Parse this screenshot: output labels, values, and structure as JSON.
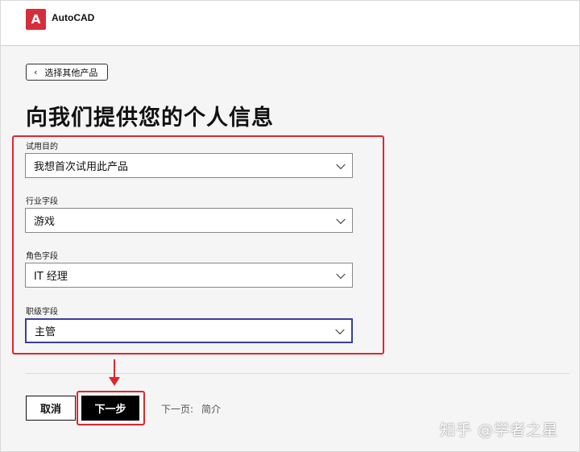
{
  "header": {
    "logo_letter": "A",
    "app_name": "AutoCAD"
  },
  "back_button": {
    "label": "选择其他产品"
  },
  "page_title": "向我们提供您的个人信息",
  "fields": [
    {
      "label": "试用目的",
      "value": "我想首次试用此产品"
    },
    {
      "label": "行业字段",
      "value": "游戏"
    },
    {
      "label": "角色字段",
      "value": "IT 经理"
    },
    {
      "label": "职级字段",
      "value": "主管"
    }
  ],
  "footer": {
    "cancel_label": "取消",
    "next_label": "下一步",
    "next_page_prefix": "下一页:",
    "next_page_name": "简介"
  },
  "watermark": "知乎 @学者之星",
  "colors": {
    "annotation_red": "#e0262e",
    "focus_border": "#3a3f9e",
    "brand_red": "#d62d3a"
  }
}
